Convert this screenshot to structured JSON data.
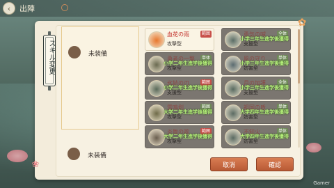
{
  "screen": {
    "title": "出陣",
    "back_icon": "back-arrow-icon"
  },
  "dialog": {
    "side_title": "スキル変更",
    "slots": [
      {
        "label": "未装備"
      },
      {
        "label": "未装備"
      }
    ],
    "skills": [
      {
        "name": "血花の雨",
        "type": "攻撃型",
        "badge": "範囲",
        "badge_color": "#c8504a",
        "locked": false,
        "lock_text": "",
        "icon_color": "#e8772e"
      },
      {
        "name": "勇気の喊",
        "type": "支援型",
        "badge": "全体",
        "badge_color": "#6f8a58",
        "locked": true,
        "lock_text": "小学三年生進学後獲得",
        "icon_color": "#5a6d66"
      },
      {
        "name": "勇者の一撃",
        "type": "攻撃型",
        "badge": "単体",
        "badge_color": "#6f8a58",
        "locked": true,
        "lock_text": "小学二年生進学後獲得",
        "icon_color": "#6a6a50"
      },
      {
        "name": "風の守り",
        "type": "妨害型",
        "badge": "単体",
        "badge_color": "#6f8a58",
        "locked": true,
        "lock_text": "小学三年生進学後獲得",
        "icon_color": "#5a6b70"
      },
      {
        "name": "氷結の刃",
        "type": "支援型",
        "badge": "範囲",
        "badge_color": "#c8504a",
        "locked": true,
        "lock_text": "小学二年生進学後獲得",
        "icon_color": "#5a6a5a"
      },
      {
        "name": "月の加護",
        "type": "支援型",
        "badge": "全体",
        "badge_color": "#6f8a58",
        "locked": true,
        "lock_text": "小学三年生進学後獲得",
        "icon_color": "#586a60"
      },
      {
        "name": "雷鳴剣",
        "type": "攻撃型",
        "badge": "範囲",
        "badge_color": "#6f8a58",
        "locked": true,
        "lock_text": "大学二年生進学後獲得",
        "icon_color": "#6e6a48"
      },
      {
        "name": "祖国の盾",
        "type": "妨害型",
        "badge": "単体",
        "badge_color": "#6f8a58",
        "locked": true,
        "lock_text": "大学四年生進学後獲得",
        "icon_color": "#5a6a62"
      },
      {
        "name": "炎舞の歌",
        "type": "攻撃型",
        "badge": "範囲",
        "badge_color": "#c8504a",
        "locked": true,
        "lock_text": "大学二年生進学後獲得",
        "icon_color": "#6a5e4e"
      },
      {
        "name": "不知火",
        "type": "妨害型",
        "badge": "単体",
        "badge_color": "#6f8a58",
        "locked": true,
        "lock_text": "大学四年生進学後獲得",
        "icon_color": "#5a6a62"
      }
    ],
    "cancel_label": "取消",
    "confirm_label": "確認"
  },
  "watermark": "Gamer"
}
